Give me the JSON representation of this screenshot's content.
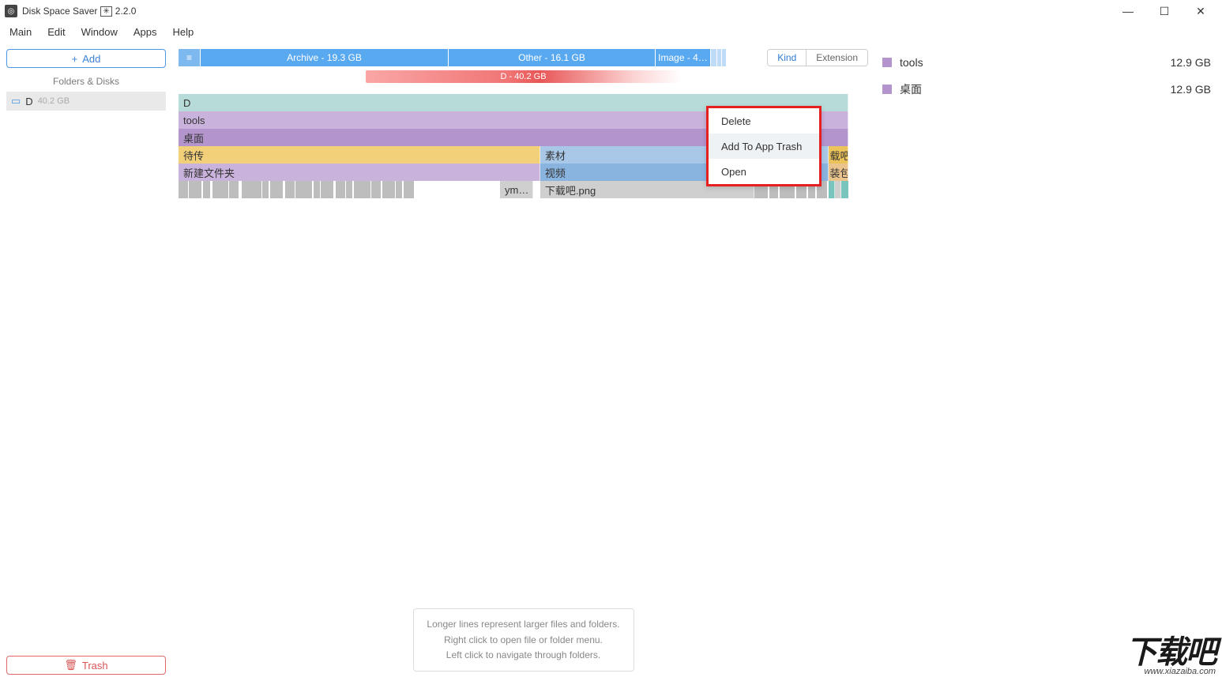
{
  "window": {
    "title": "Disk Space Saver",
    "version": "2.2.0",
    "version_symbol": "✳"
  },
  "menubar": [
    "Main",
    "Edit",
    "Window",
    "Apps",
    "Help"
  ],
  "sidebar": {
    "add_label": "Add",
    "folders_label": "Folders & Disks",
    "disk": {
      "name": "D",
      "size": "40.2 GB"
    },
    "trash_label": "Trash"
  },
  "categories": {
    "archive": "Archive - 19.3 GB",
    "other": "Other - 16.1 GB",
    "image": "Image - 4…"
  },
  "toggle": {
    "kind": "Kind",
    "extension": "Extension"
  },
  "total_bar": "D - 40.2 GB",
  "treemap": {
    "r0": "D",
    "r1": "tools",
    "r2": "桌面",
    "r3a": "待传",
    "r3b": "素材",
    "r3c": "载吧",
    "r4a": "新建文件夹",
    "r4b": "视频",
    "r4c": "装包",
    "r5a": "ym…",
    "r5b": "下载吧.png"
  },
  "context_menu": {
    "delete": "Delete",
    "add_trash": "Add To App Trash",
    "open": "Open"
  },
  "right_items": [
    {
      "name": "tools",
      "size": "12.9 GB"
    },
    {
      "name": "桌面",
      "size": "12.9 GB"
    }
  ],
  "hint": {
    "l1": "Longer lines represent larger files and folders.",
    "l2": "Right click to open file or folder menu.",
    "l3": "Left click to navigate through folders."
  },
  "watermark": {
    "big": "下载吧",
    "url": "www.xiazaiba.com"
  }
}
